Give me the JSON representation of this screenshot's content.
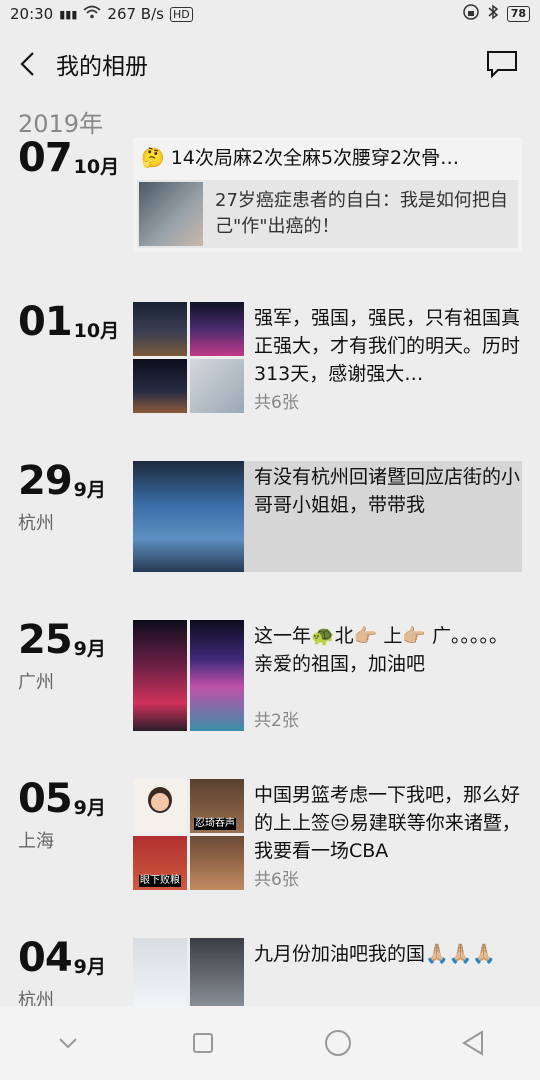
{
  "status_bar": {
    "time": "20:30",
    "signal": "4G",
    "speed": "267 B/s",
    "hd": "HD",
    "battery": "78"
  },
  "header": {
    "title": "我的相册"
  },
  "year_label": "2019年",
  "entries": [
    {
      "day": "07",
      "month": "10月",
      "city": "",
      "share_title": "🤔 14次局麻2次全麻5次腰穿2次骨…",
      "share_card_text": "27岁癌症患者的自白：我是如何把自己\"作\"出癌的！"
    },
    {
      "day": "01",
      "month": "10月",
      "city": "",
      "text": "强军，强国，强民，只有祖国真正强大，才有我们的明天。历时313天，感谢强大…",
      "count": "共6张",
      "thumbs": [
        "tiananmen-night",
        "canton-tower-night",
        "skyline-night",
        "document-photo"
      ]
    },
    {
      "day": "29",
      "month": "9月",
      "city": "杭州",
      "text": "有没有杭州回诸暨回应店街的小哥哥小姐姐，带带我",
      "thumbs": [
        "basketball-billboard"
      ]
    },
    {
      "day": "25",
      "month": "9月",
      "city": "广州",
      "text": "这一年🐢北👉🏼 上👉🏼 广。。。。。亲爱的祖国，加油吧",
      "count": "共2张",
      "thumbs": [
        "canton-tower-red",
        "canton-tower-color"
      ]
    },
    {
      "day": "05",
      "month": "9月",
      "city": "上海",
      "text": "中国男篮考虑一下我吧，那么好的上上签😒易建联等你来诸暨，我要看一场CBA",
      "count": "共6张",
      "thumbs": [
        "sticker-girl",
        "sticker-man",
        "sticker-player",
        "sticker-face"
      ],
      "sticker_captions": [
        "",
        "忍琦吞声",
        "眼下败粮",
        ""
      ]
    },
    {
      "day": "04",
      "month": "9月",
      "city": "杭州",
      "text": "九月份加油吧我的国🙏🏼🙏🏼🙏🏼",
      "thumbs": [
        "medicine-box",
        "speaker-photo"
      ]
    }
  ],
  "colors": {
    "background": "#ededed",
    "accent_text": "#111111",
    "secondary_text": "#888888"
  }
}
